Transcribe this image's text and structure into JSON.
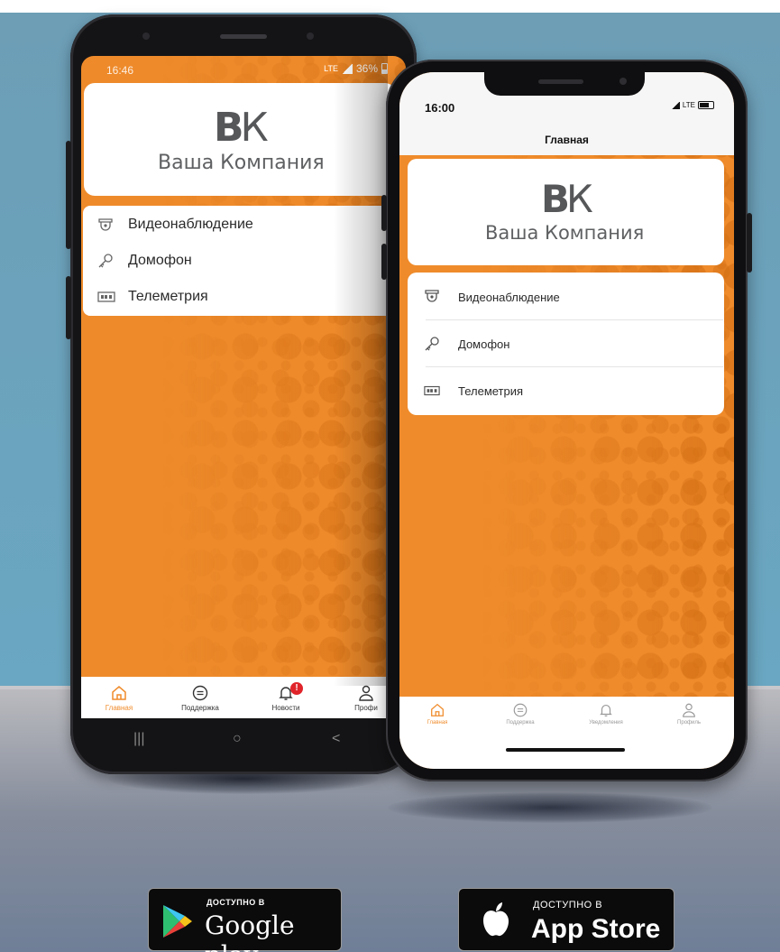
{
  "android": {
    "status_time": "16:46",
    "status_network": "LTE",
    "status_battery": "36%",
    "logo_mark_b": "В",
    "logo_mark_k": "К",
    "company_name": "Ваша Компания",
    "menu": [
      {
        "label": "Видеонаблюдение",
        "icon": "camera-icon"
      },
      {
        "label": "Домофон",
        "icon": "key-icon"
      },
      {
        "label": "Телеметрия",
        "icon": "meter-icon"
      }
    ],
    "tabs": [
      {
        "label": "Главная",
        "icon": "home-icon",
        "active": true
      },
      {
        "label": "Поддержка",
        "icon": "chat-icon"
      },
      {
        "label": "Новости",
        "icon": "bell-icon",
        "badge": "!"
      },
      {
        "label": "Профи",
        "icon": "user-icon"
      }
    ],
    "nav": {
      "recent": "|||",
      "home": "○",
      "back": "<"
    }
  },
  "iphone": {
    "status_time": "16:00",
    "status_network": "LTE",
    "title": "Главная",
    "logo_mark_b": "В",
    "logo_mark_k": "К",
    "company_name": "Ваша Компания",
    "menu": [
      {
        "label": "Видеонаблюдение",
        "icon": "camera-icon"
      },
      {
        "label": "Домофон",
        "icon": "key-icon"
      },
      {
        "label": "Телеметрия",
        "icon": "meter-icon"
      }
    ],
    "tabs": [
      {
        "label": "Главная",
        "icon": "home-icon",
        "active": true
      },
      {
        "label": "Поддержка",
        "icon": "chat-icon"
      },
      {
        "label": "Уведомления",
        "icon": "bell-icon"
      },
      {
        "label": "Профиль",
        "icon": "user-icon"
      }
    ]
  },
  "stores": {
    "google": {
      "small": "ДОСТУПНО В",
      "big": "Google play"
    },
    "apple": {
      "small": "ДОСТУПНО В",
      "big": "App Store"
    }
  },
  "colors": {
    "accent": "#ee8a2a",
    "badge": "#e0242a",
    "background": "#6aa7c2"
  }
}
